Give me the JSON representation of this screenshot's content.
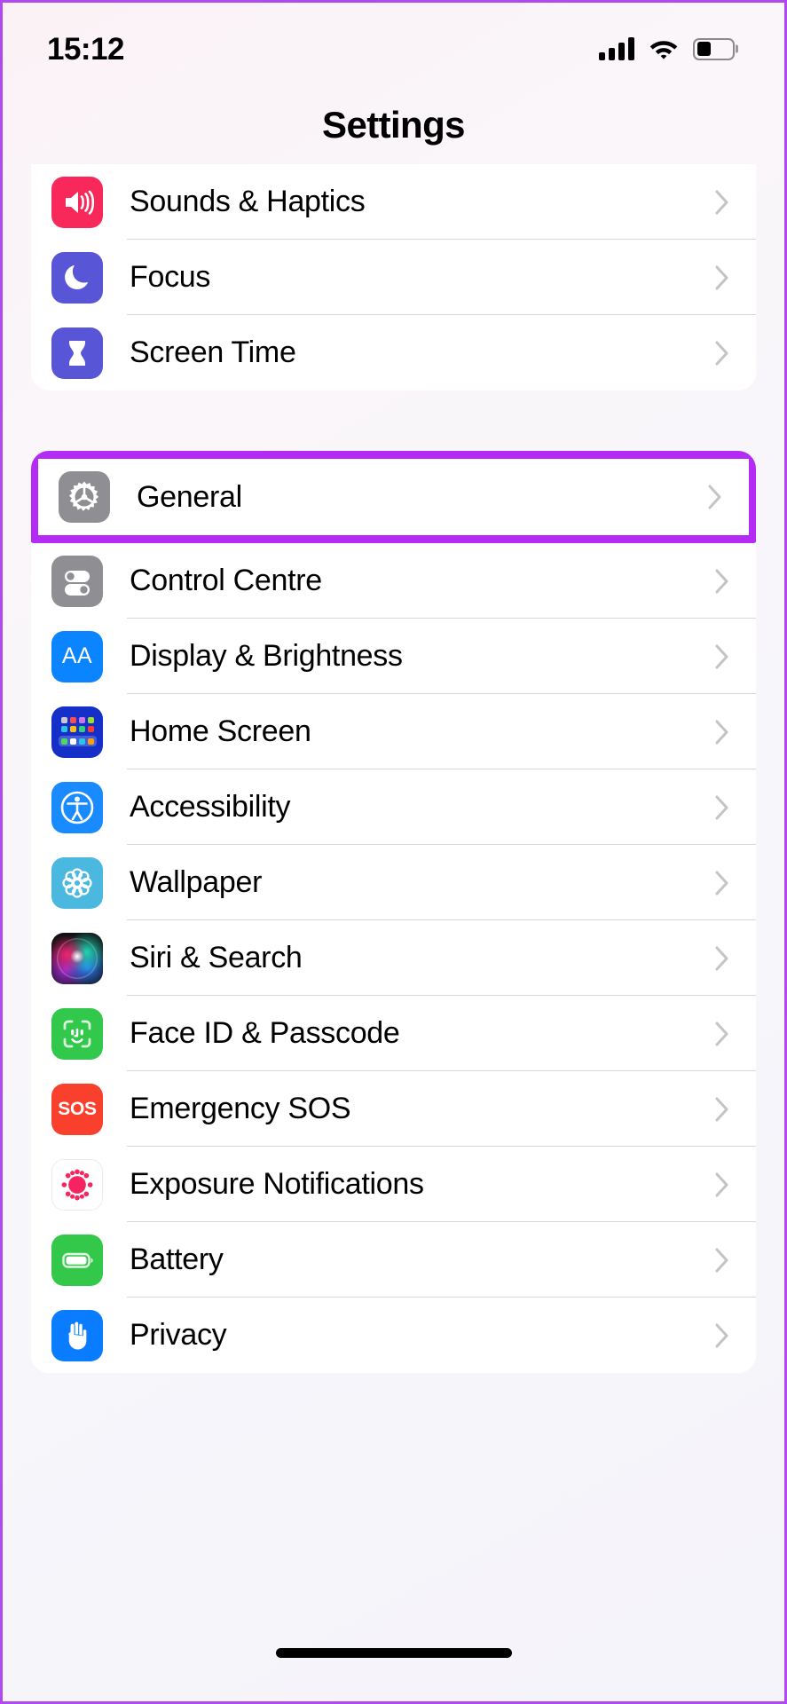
{
  "status_bar": {
    "time": "15:12",
    "signal_icon": "cellular-signal-icon",
    "wifi_icon": "wifi-icon",
    "battery_icon": "battery-icon",
    "battery_level_percent": 40
  },
  "nav": {
    "title": "Settings"
  },
  "highlight": {
    "color": "#B32BF5",
    "target_row": "General"
  },
  "groups": [
    {
      "id": "group-personalization",
      "clipped_top": true,
      "rows": [
        {
          "label": "Sounds & Haptics",
          "icon": "sounds-haptics-icon",
          "icon_color": "#F8295A",
          "chevron": "chevron-right-icon"
        },
        {
          "label": "Focus",
          "icon": "focus-moon-icon",
          "icon_color": "#5856D6",
          "chevron": "chevron-right-icon"
        },
        {
          "label": "Screen Time",
          "icon": "screen-time-hourglass-icon",
          "icon_color": "#5856D6",
          "chevron": "chevron-right-icon"
        }
      ]
    },
    {
      "id": "group-system",
      "rows": [
        {
          "label": "General",
          "icon": "general-gear-icon",
          "icon_color": "#8E8E93",
          "chevron": "chevron-right-icon",
          "highlighted": true
        },
        {
          "label": "Control Centre",
          "icon": "control-centre-toggles-icon",
          "icon_color": "#8E8E93",
          "chevron": "chevron-right-icon"
        },
        {
          "label": "Display & Brightness",
          "icon": "display-brightness-aa-icon",
          "icon_color": "#0A84FF",
          "chevron": "chevron-right-icon"
        },
        {
          "label": "Home Screen",
          "icon": "home-screen-grid-icon",
          "icon_color": "#1430C8",
          "chevron": "chevron-right-icon"
        },
        {
          "label": "Accessibility",
          "icon": "accessibility-person-icon",
          "icon_color": "#1A8BFF",
          "chevron": "chevron-right-icon"
        },
        {
          "label": "Wallpaper",
          "icon": "wallpaper-flower-icon",
          "icon_color": "#4BB8E0",
          "chevron": "chevron-right-icon"
        },
        {
          "label": "Siri & Search",
          "icon": "siri-orb-icon",
          "icon_color": "#121014",
          "chevron": "chevron-right-icon"
        },
        {
          "label": "Face ID & Passcode",
          "icon": "face-id-icon",
          "icon_color": "#32C84B",
          "chevron": "chevron-right-icon"
        },
        {
          "label": "Emergency SOS",
          "icon": "emergency-sos-icon",
          "icon_color": "#F8402C",
          "chevron": "chevron-right-icon"
        },
        {
          "label": "Exposure Notifications",
          "icon": "exposure-notifications-icon",
          "icon_color": "#FFFFFF",
          "chevron": "chevron-right-icon"
        },
        {
          "label": "Battery",
          "icon": "battery-green-icon",
          "icon_color": "#33C84A",
          "chevron": "chevron-right-icon"
        },
        {
          "label": "Privacy",
          "icon": "privacy-hand-icon",
          "icon_color": "#0A7CFF",
          "chevron": "chevron-right-icon"
        }
      ]
    }
  ],
  "home_indicator": "home-indicator"
}
